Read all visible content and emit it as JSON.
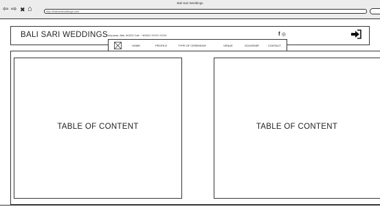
{
  "browser": {
    "title": "Bali Sari Weddings",
    "url": "http://balisariweddings.com",
    "buttons": {
      "back": "⇦",
      "forward": "⇨",
      "close": "✖",
      "home": "⌂"
    }
  },
  "header": {
    "brand": "BALI SARI WEDDINGS",
    "contact": "Denpasar, Bali, 80223    Call : +62812 XXXX XXXX",
    "social": {
      "facebook": "f",
      "instagram": "◎"
    }
  },
  "nav": {
    "items": [
      {
        "label": "HOME"
      },
      {
        "label": "PROFILE"
      },
      {
        "label": "TYPE OF CEREMONY"
      },
      {
        "label": "VENUE"
      },
      {
        "label": "SOUVENIR"
      },
      {
        "label": "CONTACT"
      }
    ]
  },
  "panels": {
    "left": {
      "label": "TABLE OF CONTENT"
    },
    "right": {
      "label": "TABLE OF CONTENT"
    }
  },
  "icons": [
    "back-arrow-icon",
    "forward-arrow-icon",
    "close-icon",
    "home-icon",
    "facebook-icon",
    "instagram-icon",
    "login-icon",
    "logo-placeholder-icon"
  ]
}
